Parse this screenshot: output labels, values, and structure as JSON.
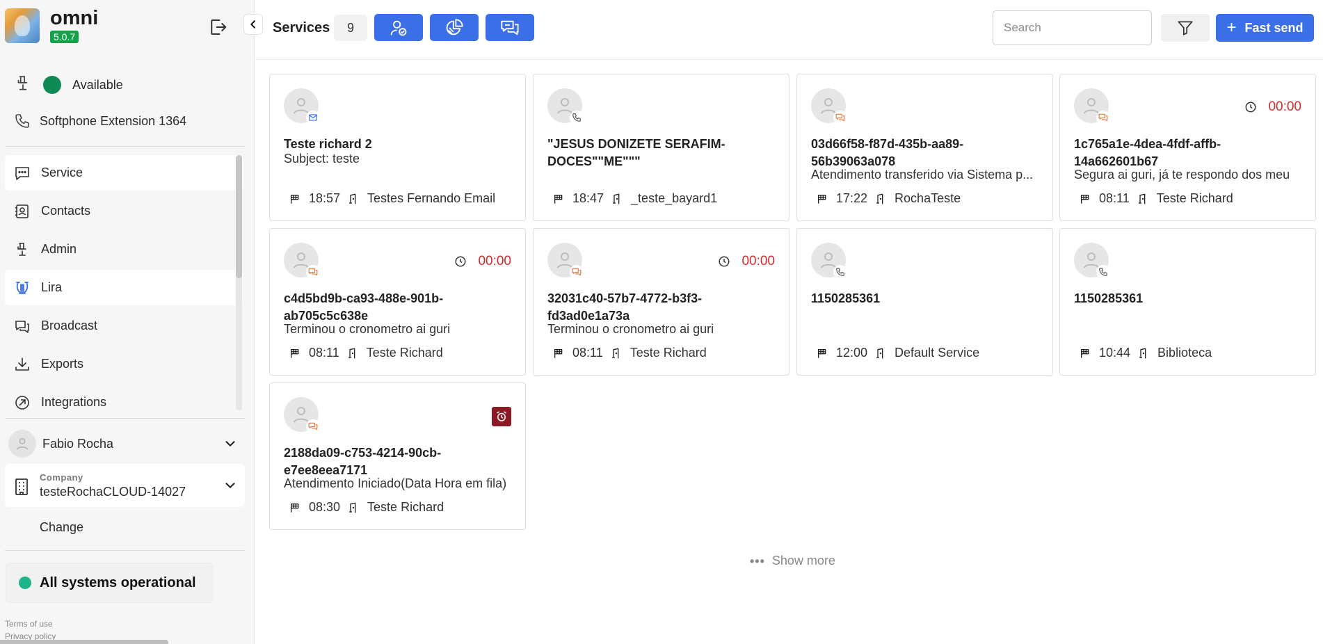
{
  "brand": {
    "name": "omni",
    "version": "5.0.7"
  },
  "sidebar": {
    "status": "Available",
    "softphone": "Softphone Extension 1364",
    "nav": [
      {
        "label": "Service",
        "icon": "chat-icon"
      },
      {
        "label": "Contacts",
        "icon": "contacts-icon"
      },
      {
        "label": "Admin",
        "icon": "admin-icon"
      },
      {
        "label": "Lira",
        "icon": "lira-icon"
      },
      {
        "label": "Broadcast",
        "icon": "broadcast-icon"
      },
      {
        "label": "Exports",
        "icon": "download-icon"
      },
      {
        "label": "Integrations",
        "icon": "integrations-icon"
      }
    ],
    "user": "Fabio Rocha",
    "company_caption": "Company",
    "company_name": "testeRochaCLOUD-14027",
    "change": "Change",
    "system_status": "All systems operational",
    "terms": "Terms of use",
    "privacy": "Privacy policy"
  },
  "topbar": {
    "title": "Services",
    "count": "9",
    "search_placeholder": "Search",
    "fast_send": "Fast send"
  },
  "cards": [
    {
      "name": "Teste richard 2",
      "desc": "Subject: teste",
      "time": "18:57",
      "queue": "Testes Fernando Email",
      "channel": "email",
      "timer": "",
      "alarm": false
    },
    {
      "name": "\"JESUS DONIZETE SERAFIM-DOCES\"\"ME\"\"\"",
      "desc": "",
      "time": "18:47",
      "queue": "_teste_bayard1",
      "channel": "phone",
      "timer": "",
      "alarm": false
    },
    {
      "name": "03d66f58-f87d-435b-aa89-56b39063a078",
      "desc": "Atendimento transferido via Sistema p...",
      "time": "17:22",
      "queue": "RochaTeste",
      "channel": "chat",
      "timer": "",
      "alarm": false
    },
    {
      "name": "1c765a1e-4dea-4fdf-affb-14a662601b67",
      "desc": "Segura ai guri, já te respondo dos meu",
      "time": "08:11",
      "queue": "Teste Richard",
      "channel": "chat",
      "timer": "00:00",
      "alarm": false
    },
    {
      "name": "c4d5bd9b-ca93-488e-901b-ab705c5c638e",
      "desc": "Terminou o cronometro ai guri",
      "time": "08:11",
      "queue": "Teste Richard",
      "channel": "chat",
      "timer": "00:00",
      "alarm": false
    },
    {
      "name": "32031c40-57b7-4772-b3f3-fd3ad0e1a73a",
      "desc": "Terminou o cronometro ai guri",
      "time": "08:11",
      "queue": "Teste Richard",
      "channel": "chat",
      "timer": "00:00",
      "alarm": false
    },
    {
      "name": "1150285361",
      "desc": "",
      "time": "12:00",
      "queue": "Default Service",
      "channel": "phone",
      "timer": "",
      "alarm": false
    },
    {
      "name": "1150285361",
      "desc": "",
      "time": "10:44",
      "queue": "Biblioteca",
      "channel": "phone",
      "timer": "",
      "alarm": false
    },
    {
      "name": "2188da09-c753-4214-90cb-e7ee8eea7171",
      "desc": "Atendimento Iniciado(Data Hora em fila)",
      "time": "08:30",
      "queue": "Teste Richard",
      "channel": "chat",
      "timer": "",
      "alarm": true
    }
  ],
  "show_more": "Show more",
  "colors": {
    "accent": "#3b6fe8",
    "available": "#0f8a55",
    "timer": "#d62b2b",
    "alarm": "#8b1a24",
    "operational": "#1fb38a",
    "chat_channel": "#e8763a",
    "email_channel": "#3b6fe8"
  }
}
